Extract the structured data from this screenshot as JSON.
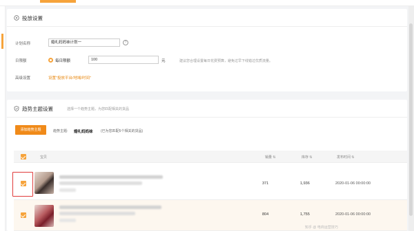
{
  "section1": {
    "title": "投放设置",
    "plan_name_label": "计划名称",
    "plan_name_value": "婚礼妈妈袜计划一",
    "daily_budget_label": "日限额",
    "radio_label": "每日限额",
    "budget_value": "100",
    "unit": "元",
    "budget_tip": "建议您合理设置每日花费预算，避免过早下线错过优质流量。",
    "advanced_label": "高级设置",
    "advanced_link": "设置\"投放平台/地域/时间\""
  },
  "section2": {
    "title": "趋势主题设置",
    "hint": "选择一个趋势主题，为您匹配相关的货品",
    "select_button": "添加趋势主题",
    "theme_label": "趋势主题:",
    "theme_value": "婚礼妈妈袜",
    "theme_note": "(已为您匹配5个相关的货品)"
  },
  "table": {
    "headers": [
      "宝贝",
      "销量 ⇅",
      "库存 ⇅",
      "发布时间 ⇅"
    ],
    "rows": [
      {
        "sales": "371",
        "stock": "1,936",
        "date": "2020-01-06 00:00:00"
      },
      {
        "sales": "804",
        "stock": "1,755",
        "date": "2020-01-06 00:00:00"
      }
    ]
  },
  "watermark": "知乎 @ 电商运营技巧",
  "colors": {
    "accent": "#f6a33b",
    "button": "#f08a19",
    "highlight": "#e03a3a"
  }
}
